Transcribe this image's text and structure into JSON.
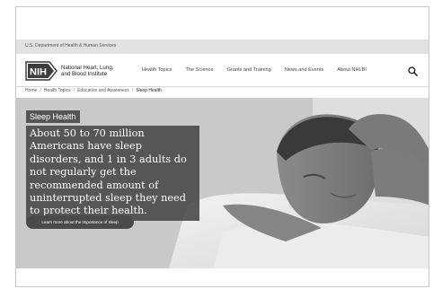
{
  "gov_banner": {
    "text": "U.S. Department of Health & Human Services"
  },
  "header": {
    "logo_mark": "NIH",
    "logo_text_line1": "National Heart, Lung,",
    "logo_text_line2": "and Blood Institute",
    "nav": [
      {
        "label": "Health Topics"
      },
      {
        "label": "The Science"
      },
      {
        "label": "Grants and Training"
      },
      {
        "label": "News and Events"
      },
      {
        "label": "About NHLBI"
      }
    ],
    "search_icon": "search-icon"
  },
  "breadcrumb": {
    "items": [
      "Home",
      "Health Topics",
      "Education and Awareness"
    ],
    "current": "Sleep Health"
  },
  "hero": {
    "tag": "Sleep Health",
    "statement": "About 50 to 70 million Americans have sleep disorders, and 1 in 3 adults do not regularly get the recommended amount of uninterrupted sleep they need to protect their health.",
    "button_label": "Learn more about the importance of sleep"
  }
}
